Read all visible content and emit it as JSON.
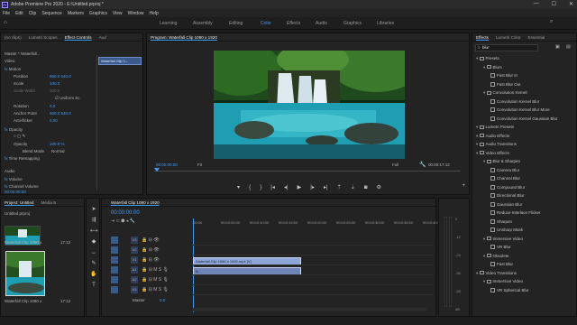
{
  "window": {
    "title": "Adobe Premiere Pro 2020 - E:\\Untitled.prproj *",
    "logo": "Pr",
    "minimize_glyph": "—",
    "maximize_glyph": "☐",
    "close_glyph": "✕"
  },
  "menu": [
    "File",
    "Edit",
    "Clip",
    "Sequence",
    "Markers",
    "Graphics",
    "View",
    "Window",
    "Help"
  ],
  "workspaces": [
    "Learning",
    "Assembly",
    "Editing",
    "Color",
    "Effects",
    "Audio",
    "Graphics",
    "Libraries"
  ],
  "active_workspace": "Color",
  "source_panel": {
    "tabs": [
      "(no clips)",
      "Lumetri Scopes",
      "Effect Controls",
      "Aud"
    ],
    "master_label": "Master * Waterfall...",
    "clip_label": "Waterfall Clip 1...",
    "video_label": "Video",
    "props": [
      {
        "name": "Motion",
        "value": ""
      },
      {
        "name": "Position",
        "value": "960.0   540.0"
      },
      {
        "name": "Scale",
        "value": "100.0"
      },
      {
        "name": "Scale Width",
        "value": "100.0"
      },
      {
        "name": "Uniform Sc",
        "value": ""
      },
      {
        "name": "Rotation",
        "value": "0.0"
      },
      {
        "name": "Anchor Point",
        "value": "960.0   540.0"
      },
      {
        "name": "Anti-flicker",
        "value": "0.00"
      },
      {
        "name": "Opacity",
        "value": ""
      },
      {
        "name": "Opacity",
        "value": "100.0 %"
      },
      {
        "name": "Blend Mode",
        "value": "Normal"
      },
      {
        "name": "Time Remapping",
        "value": ""
      }
    ],
    "audio_label": "Audio",
    "audio_props": [
      "Volume",
      "Channel Volume"
    ],
    "timecode": "00:00:00:00",
    "timeline_clip": "Waterfall Clip 1080 x"
  },
  "program": {
    "title": "Program: Waterfall Clip 1080 x 1920",
    "timecode_left": "00:00:00:00",
    "fit": "Fit",
    "quality": "Full",
    "timecode_right": "00:00:17:12"
  },
  "project": {
    "tabs": [
      "Project: Untitled",
      "Media B"
    ],
    "file": "Untitled.prproj",
    "items": [
      {
        "name": "Waterfall Clip 1080 x",
        "duration": "17:12"
      },
      {
        "name": "Waterfall Clip 1080 x",
        "duration": "17:12"
      }
    ]
  },
  "timeline": {
    "title": "Waterfall Clip 1080 x 1920",
    "timecode": "00:00:00:00",
    "ruler": [
      ":00:00",
      "00:00:05:00",
      "00:00:10:00",
      "00:00:15:00",
      "00:00:20:00",
      "00:00:25:00",
      "00:00:30:00",
      "00:00:35:00",
      "00:00:40:00"
    ],
    "video_tracks": [
      "V3",
      "V2",
      "V1"
    ],
    "audio_tracks": [
      "A1",
      "A2",
      "A3"
    ],
    "master": "Master",
    "master_value": "0.0",
    "video_clip": "Waterfall Clip 1080 x 1920.mp4 [V]",
    "audio_clip": "fx"
  },
  "effects": {
    "tabs": [
      "Effects",
      "Lumetri Color",
      "Essential"
    ],
    "search_value": "blur",
    "items": [
      {
        "label": "Presets",
        "level": 0,
        "type": "folder"
      },
      {
        "label": "Blurs",
        "level": 1,
        "type": "folder"
      },
      {
        "label": "Fast Blur In",
        "level": 2,
        "type": "fx"
      },
      {
        "label": "Fast Blur Out",
        "level": 2,
        "type": "fx"
      },
      {
        "label": "Convolution Kernel",
        "level": 1,
        "type": "folder"
      },
      {
        "label": "Convolution Kernel Blur",
        "level": 2,
        "type": "fx"
      },
      {
        "label": "Convolution Kernel Blur More",
        "level": 2,
        "type": "fx"
      },
      {
        "label": "Convolution Kernel Gaussian Blur",
        "level": 2,
        "type": "fx"
      },
      {
        "label": "Lumetri Presets",
        "level": 0,
        "type": "folder"
      },
      {
        "label": "Audio Effects",
        "level": 0,
        "type": "folder"
      },
      {
        "label": "Audio Transitions",
        "level": 0,
        "type": "folder"
      },
      {
        "label": "Video Effects",
        "level": 0,
        "type": "folder"
      },
      {
        "label": "Blur & Sharpen",
        "level": 1,
        "type": "folder"
      },
      {
        "label": "Camera Blur",
        "level": 2,
        "type": "fx"
      },
      {
        "label": "Channel Blur",
        "level": 2,
        "type": "fx"
      },
      {
        "label": "Compound Blur",
        "level": 2,
        "type": "fx"
      },
      {
        "label": "Directional Blur",
        "level": 2,
        "type": "fx"
      },
      {
        "label": "Gaussian Blur",
        "level": 2,
        "type": "fx"
      },
      {
        "label": "Reduce Interlace Flicker",
        "level": 2,
        "type": "fx"
      },
      {
        "label": "Sharpen",
        "level": 2,
        "type": "fx"
      },
      {
        "label": "Unsharp Mask",
        "level": 2,
        "type": "fx"
      },
      {
        "label": "Immersive Video",
        "level": 1,
        "type": "folder"
      },
      {
        "label": "VR Blur",
        "level": 2,
        "type": "fx"
      },
      {
        "label": "Obsolete",
        "level": 1,
        "type": "folder"
      },
      {
        "label": "Fast Blur",
        "level": 2,
        "type": "fx"
      },
      {
        "label": "Video Transitions",
        "level": 0,
        "type": "folder"
      },
      {
        "label": "Immersive Video",
        "level": 1,
        "type": "folder"
      },
      {
        "label": "VR Spherical Blur",
        "level": 2,
        "type": "fx"
      }
    ]
  },
  "meter_labels": [
    "0",
    "-12",
    "-24",
    "-36",
    "-48",
    "dB"
  ],
  "icons": {
    "tools": [
      "selection-tool",
      "track-select-tool",
      "ripple-edit-tool",
      "razor-tool",
      "slip-tool",
      "pen-tool",
      "hand-tool",
      "type-tool"
    ]
  }
}
